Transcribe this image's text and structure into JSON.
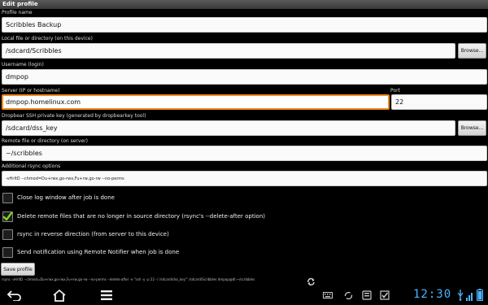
{
  "window": {
    "title": "Edit profile"
  },
  "form": {
    "profile_name": {
      "label": "Profile name",
      "value": "Scribbles Backup"
    },
    "local_path": {
      "label": "Local file or directory (on this device)",
      "value": "/sdcard/Scribbles",
      "browse_label": "Browse..."
    },
    "username": {
      "label": "Username (login)",
      "value": "dmpop"
    },
    "server": {
      "label": "Server (IP or hostname)",
      "value": "dmpop.homelinux.com"
    },
    "port": {
      "label": "Port",
      "value": "22"
    },
    "ssh_key": {
      "label": "Dropbear SSH private key (generated by dropbearkey tool)",
      "value": "/sdcard/dss_key",
      "browse_label": "Browse..."
    },
    "remote_path": {
      "label": "Remote file or directory (on server)",
      "value": "~/scribbles"
    },
    "rsync_options": {
      "label": "Additional rsync options",
      "value": "-vHrltD --chmod=Du+rwx,go-rwx,Fu+rw,go-rw --no-perms"
    }
  },
  "checkboxes": [
    {
      "label": "Close log window after job is done",
      "checked": false
    },
    {
      "label": "Delete remote files that are no longer in source directory (rsync's --delete-after option)",
      "checked": true
    },
    {
      "label": "rsync in reverse direction (from server to this device)",
      "checked": false
    },
    {
      "label": "Send notification using Remote Notifier when job is done",
      "checked": false
    }
  ],
  "save_button": {
    "label": "Save profile"
  },
  "command_preview": "rsync -vHrltD --chmod=Du+rwx,go-rwx,Fu+rw,go-rw --no-perms --delete-after -e \"ssh -y -p 22 -i '/sdcard/dss_key'\" /sdcard/Scribbles dmpop@dl:~/scribbles",
  "system_bar": {
    "clock": "12:30",
    "icons": [
      "back-icon",
      "home-icon",
      "recent-apps-icon",
      "keyboard-icon",
      "sync-icon",
      "notification-icon",
      "checkbox-notification-icon",
      "usb-icon",
      "signal-icon",
      "battery-icon",
      "rotate-icon"
    ],
    "accent_color": "#4db3ff"
  }
}
